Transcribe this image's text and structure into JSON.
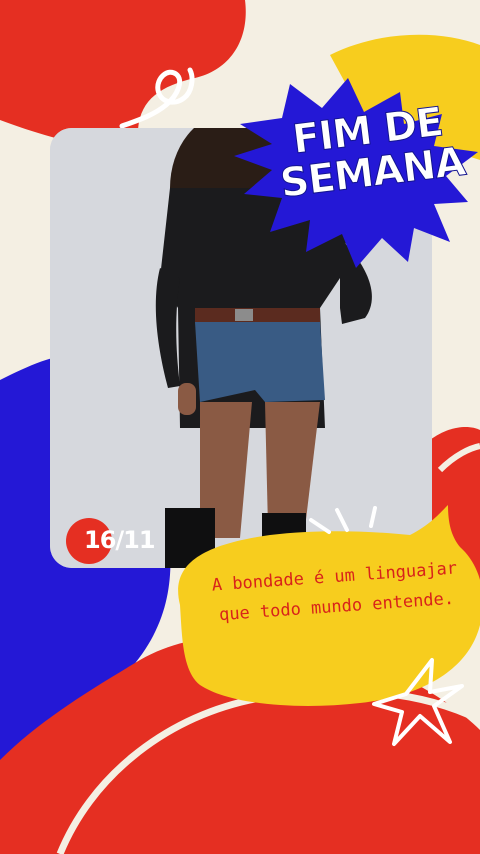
{
  "headline": {
    "line1": "FIM DE",
    "line2": "SEMANA"
  },
  "date": "16/11",
  "quote": "A bondade é um linguajar que todo mundo entende.",
  "colors": {
    "cream": "#f4efe3",
    "red": "#e52f22",
    "blue": "#2418d6",
    "yellow": "#f7cd1e",
    "white": "#ffffff"
  },
  "icons": {
    "star": "star-icon",
    "squiggle": "squiggle-icon",
    "sparkle": "sparkle-lines-icon"
  }
}
